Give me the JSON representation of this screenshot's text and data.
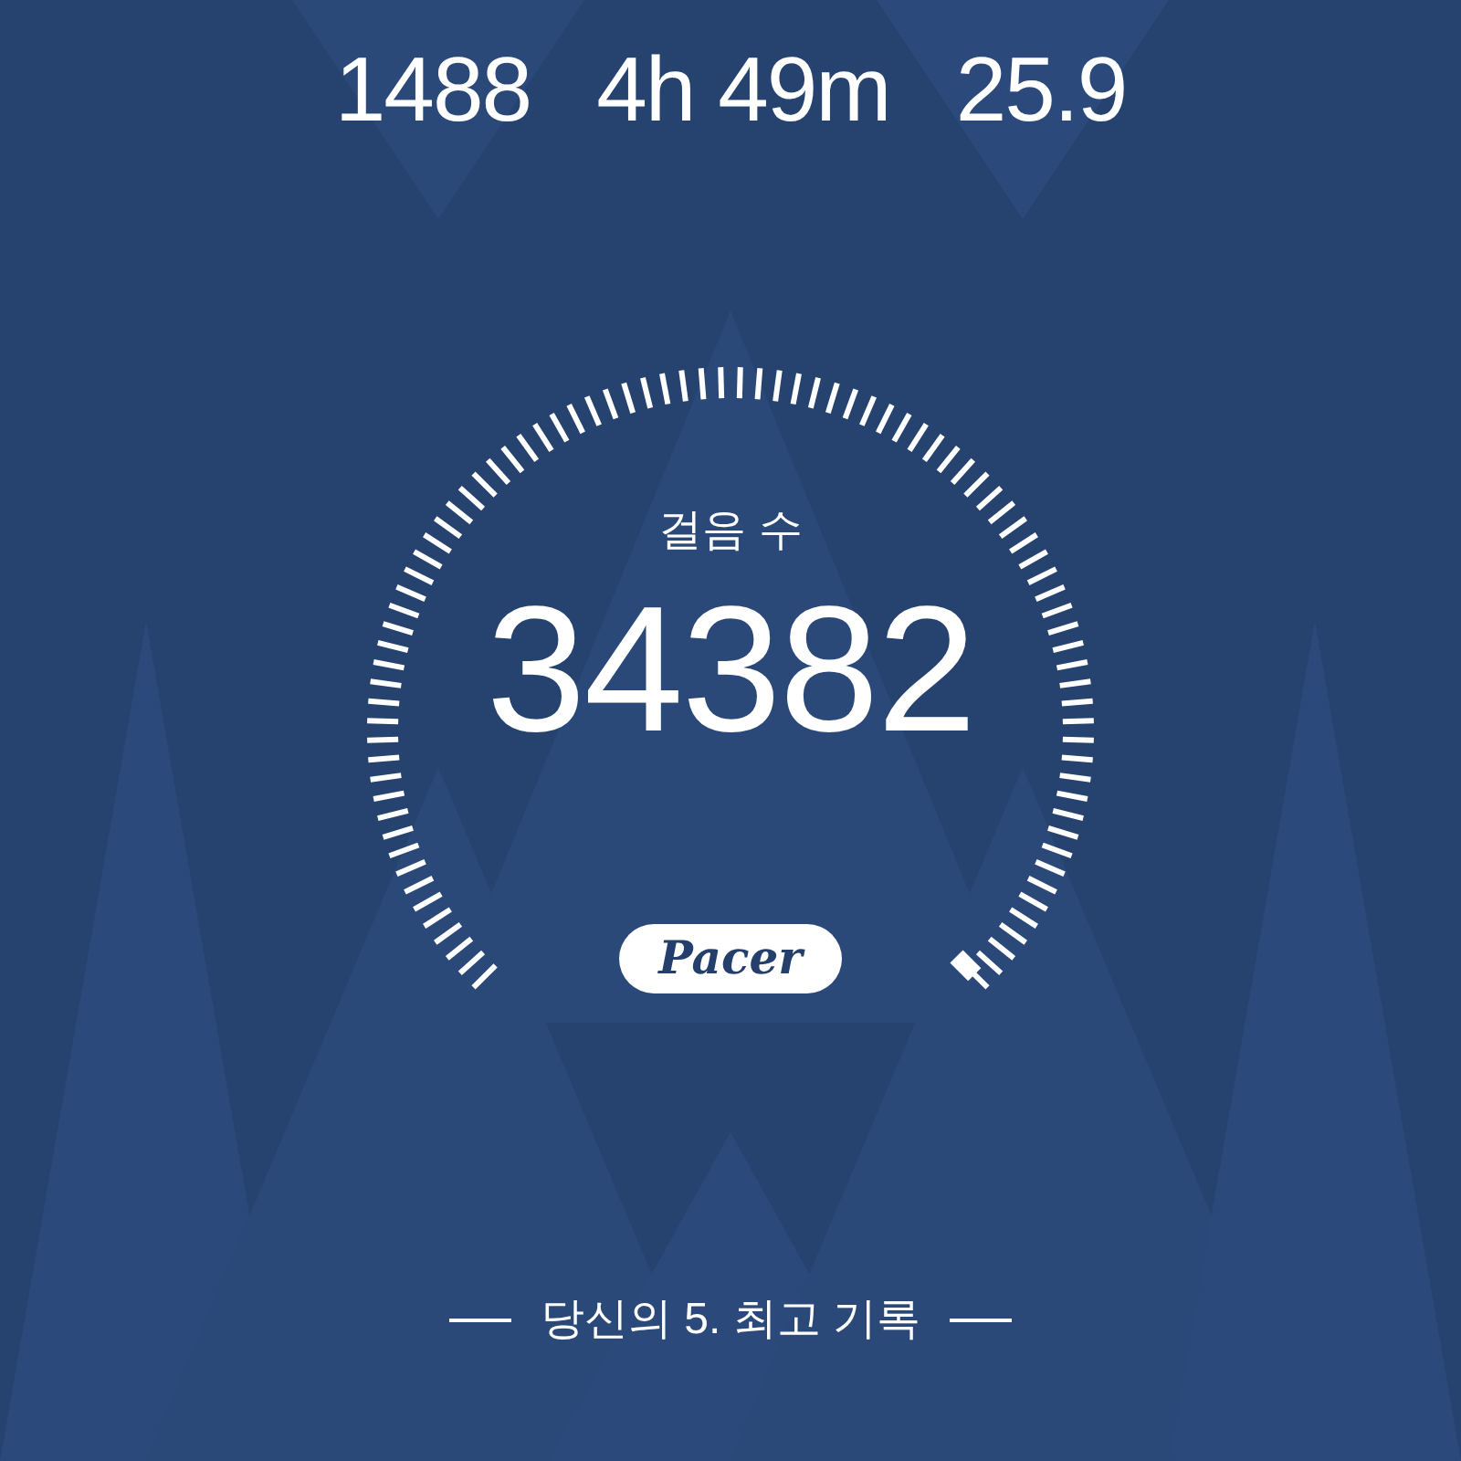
{
  "stats": [
    {
      "value": "1488"
    },
    {
      "value": "4h 49m"
    },
    {
      "value": "25.9"
    }
  ],
  "gauge": {
    "label": "걸음 수",
    "value": "34382",
    "logo": "Pacer"
  },
  "footer": {
    "caption": "당신의 5. 최고 기록"
  }
}
